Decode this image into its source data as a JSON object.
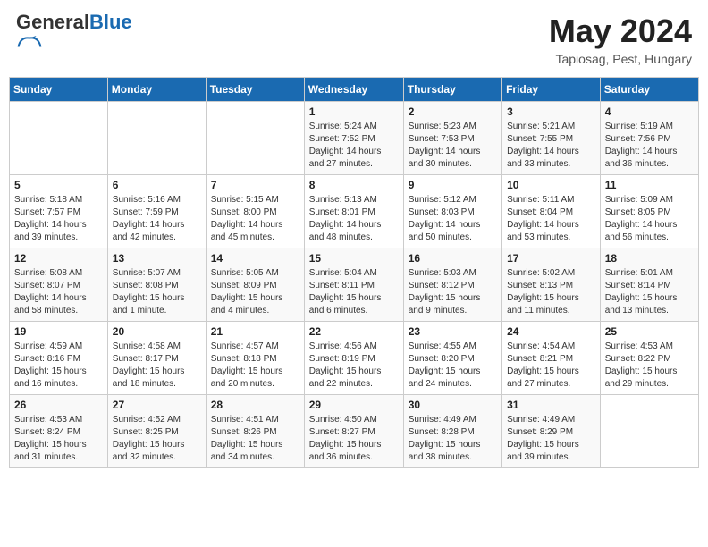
{
  "header": {
    "logo_general": "General",
    "logo_blue": "Blue",
    "month_title": "May 2024",
    "location": "Tapiosag, Pest, Hungary"
  },
  "weekdays": [
    "Sunday",
    "Monday",
    "Tuesday",
    "Wednesday",
    "Thursday",
    "Friday",
    "Saturday"
  ],
  "weeks": [
    [
      {
        "day": "",
        "info": ""
      },
      {
        "day": "",
        "info": ""
      },
      {
        "day": "",
        "info": ""
      },
      {
        "day": "1",
        "info": "Sunrise: 5:24 AM\nSunset: 7:52 PM\nDaylight: 14 hours\nand 27 minutes."
      },
      {
        "day": "2",
        "info": "Sunrise: 5:23 AM\nSunset: 7:53 PM\nDaylight: 14 hours\nand 30 minutes."
      },
      {
        "day": "3",
        "info": "Sunrise: 5:21 AM\nSunset: 7:55 PM\nDaylight: 14 hours\nand 33 minutes."
      },
      {
        "day": "4",
        "info": "Sunrise: 5:19 AM\nSunset: 7:56 PM\nDaylight: 14 hours\nand 36 minutes."
      }
    ],
    [
      {
        "day": "5",
        "info": "Sunrise: 5:18 AM\nSunset: 7:57 PM\nDaylight: 14 hours\nand 39 minutes."
      },
      {
        "day": "6",
        "info": "Sunrise: 5:16 AM\nSunset: 7:59 PM\nDaylight: 14 hours\nand 42 minutes."
      },
      {
        "day": "7",
        "info": "Sunrise: 5:15 AM\nSunset: 8:00 PM\nDaylight: 14 hours\nand 45 minutes."
      },
      {
        "day": "8",
        "info": "Sunrise: 5:13 AM\nSunset: 8:01 PM\nDaylight: 14 hours\nand 48 minutes."
      },
      {
        "day": "9",
        "info": "Sunrise: 5:12 AM\nSunset: 8:03 PM\nDaylight: 14 hours\nand 50 minutes."
      },
      {
        "day": "10",
        "info": "Sunrise: 5:11 AM\nSunset: 8:04 PM\nDaylight: 14 hours\nand 53 minutes."
      },
      {
        "day": "11",
        "info": "Sunrise: 5:09 AM\nSunset: 8:05 PM\nDaylight: 14 hours\nand 56 minutes."
      }
    ],
    [
      {
        "day": "12",
        "info": "Sunrise: 5:08 AM\nSunset: 8:07 PM\nDaylight: 14 hours\nand 58 minutes."
      },
      {
        "day": "13",
        "info": "Sunrise: 5:07 AM\nSunset: 8:08 PM\nDaylight: 15 hours\nand 1 minute."
      },
      {
        "day": "14",
        "info": "Sunrise: 5:05 AM\nSunset: 8:09 PM\nDaylight: 15 hours\nand 4 minutes."
      },
      {
        "day": "15",
        "info": "Sunrise: 5:04 AM\nSunset: 8:11 PM\nDaylight: 15 hours\nand 6 minutes."
      },
      {
        "day": "16",
        "info": "Sunrise: 5:03 AM\nSunset: 8:12 PM\nDaylight: 15 hours\nand 9 minutes."
      },
      {
        "day": "17",
        "info": "Sunrise: 5:02 AM\nSunset: 8:13 PM\nDaylight: 15 hours\nand 11 minutes."
      },
      {
        "day": "18",
        "info": "Sunrise: 5:01 AM\nSunset: 8:14 PM\nDaylight: 15 hours\nand 13 minutes."
      }
    ],
    [
      {
        "day": "19",
        "info": "Sunrise: 4:59 AM\nSunset: 8:16 PM\nDaylight: 15 hours\nand 16 minutes."
      },
      {
        "day": "20",
        "info": "Sunrise: 4:58 AM\nSunset: 8:17 PM\nDaylight: 15 hours\nand 18 minutes."
      },
      {
        "day": "21",
        "info": "Sunrise: 4:57 AM\nSunset: 8:18 PM\nDaylight: 15 hours\nand 20 minutes."
      },
      {
        "day": "22",
        "info": "Sunrise: 4:56 AM\nSunset: 8:19 PM\nDaylight: 15 hours\nand 22 minutes."
      },
      {
        "day": "23",
        "info": "Sunrise: 4:55 AM\nSunset: 8:20 PM\nDaylight: 15 hours\nand 24 minutes."
      },
      {
        "day": "24",
        "info": "Sunrise: 4:54 AM\nSunset: 8:21 PM\nDaylight: 15 hours\nand 27 minutes."
      },
      {
        "day": "25",
        "info": "Sunrise: 4:53 AM\nSunset: 8:22 PM\nDaylight: 15 hours\nand 29 minutes."
      }
    ],
    [
      {
        "day": "26",
        "info": "Sunrise: 4:53 AM\nSunset: 8:24 PM\nDaylight: 15 hours\nand 31 minutes."
      },
      {
        "day": "27",
        "info": "Sunrise: 4:52 AM\nSunset: 8:25 PM\nDaylight: 15 hours\nand 32 minutes."
      },
      {
        "day": "28",
        "info": "Sunrise: 4:51 AM\nSunset: 8:26 PM\nDaylight: 15 hours\nand 34 minutes."
      },
      {
        "day": "29",
        "info": "Sunrise: 4:50 AM\nSunset: 8:27 PM\nDaylight: 15 hours\nand 36 minutes."
      },
      {
        "day": "30",
        "info": "Sunrise: 4:49 AM\nSunset: 8:28 PM\nDaylight: 15 hours\nand 38 minutes."
      },
      {
        "day": "31",
        "info": "Sunrise: 4:49 AM\nSunset: 8:29 PM\nDaylight: 15 hours\nand 39 minutes."
      },
      {
        "day": "",
        "info": ""
      }
    ]
  ]
}
